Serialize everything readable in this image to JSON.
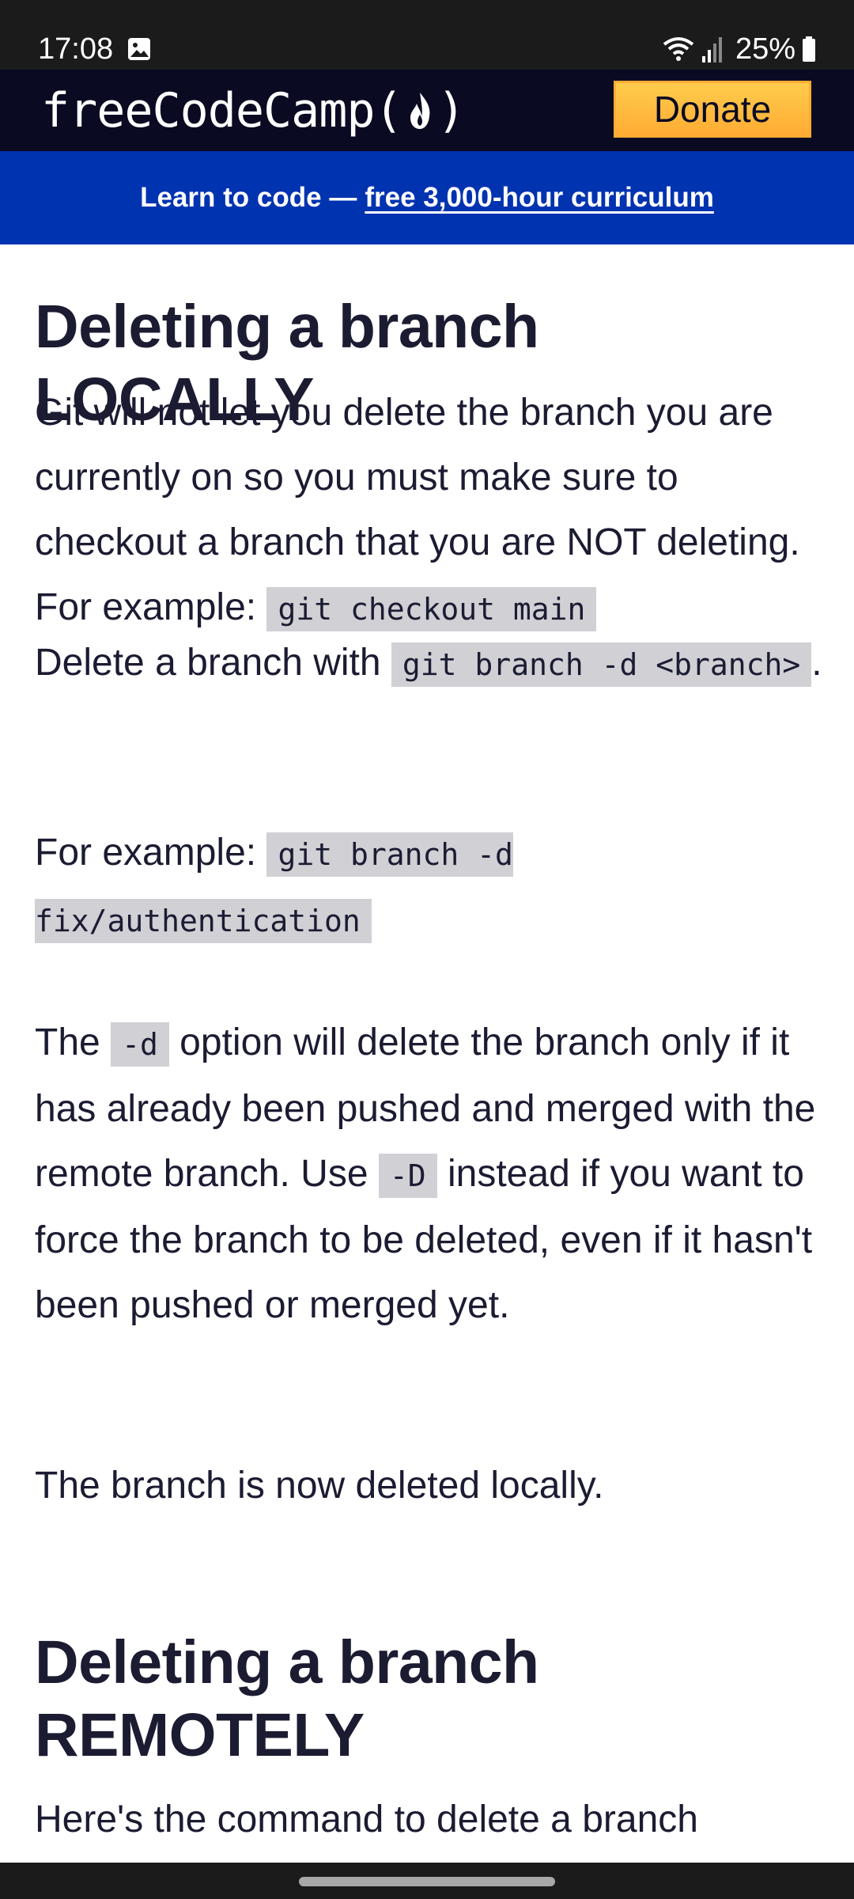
{
  "status_bar": {
    "time": "17:08",
    "battery": "25%",
    "icons": [
      "image-icon",
      "wifi-icon",
      "signal-icon",
      "battery-icon"
    ]
  },
  "nav": {
    "logo_text": "freeCodeCamp",
    "logo_open": "(",
    "logo_close": ")",
    "donate_label": "Donate",
    "colors": {
      "background": "#0a0a23",
      "donate": "#feac32"
    }
  },
  "banner": {
    "prefix": "Learn to code —",
    "link_text": "free 3,000-hour curriculum",
    "color": "#0033b0"
  },
  "article": {
    "heading_local": "Deleting a branch LOCALLY",
    "p1_text": "Git will not let you delete the branch you are currently on so you must make sure to checkout a branch that you are NOT deleting. For example:",
    "p1_code": "git checkout main",
    "p2_text": "Delete a branch with",
    "p2_code": "git branch -d <branch>",
    "p2_end": ".",
    "p3_text": "For example:",
    "p3_code": "git branch -d fix/authentication",
    "p4_a": "The",
    "p4_code1": "-d",
    "p4_b": "option will delete the branch only if it has already been pushed and merged with the remote branch. Use",
    "p4_code2": "-D",
    "p4_c": "instead if you want to force the branch to be deleted, even if it hasn't been pushed or merged yet.",
    "p5_text": "The branch is now deleted locally.",
    "heading_remote": "Deleting a branch REMOTELY",
    "p6_text": "Here's the command to delete a branch"
  }
}
